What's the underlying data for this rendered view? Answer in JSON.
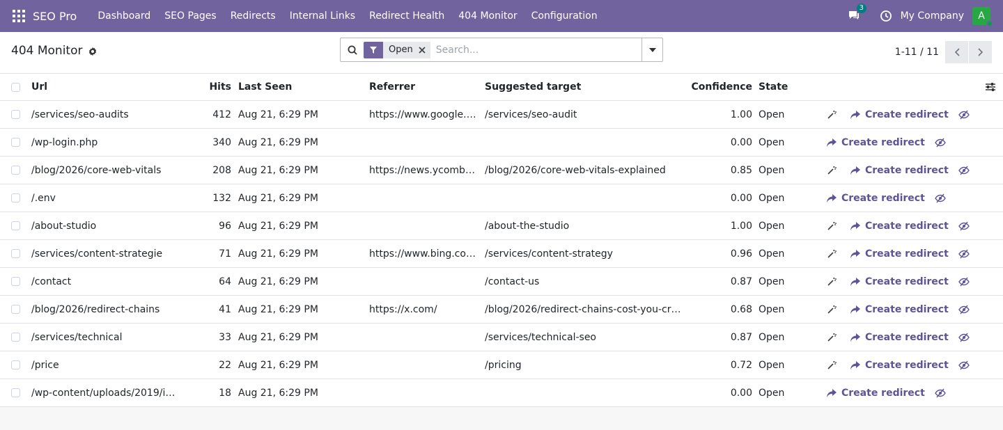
{
  "app": {
    "brand": "SEO Pro",
    "menu": [
      "Dashboard",
      "SEO Pages",
      "Redirects",
      "Internal Links",
      "Redirect Health",
      "404 Monitor",
      "Configuration"
    ],
    "chat_count": "3",
    "company": "My Company",
    "avatar_letter": "A",
    "accent_color": "#71639e"
  },
  "control": {
    "title": "404 Monitor",
    "facet": "Open",
    "search_placeholder": "Search...",
    "pager": "1-11 / 11"
  },
  "table": {
    "columns": {
      "url": "Url",
      "hits": "Hits",
      "last_seen": "Last Seen",
      "referrer": "Referrer",
      "target": "Suggested target",
      "confidence": "Confidence",
      "state": "State"
    },
    "create_label": "Create redirect",
    "rows": [
      {
        "url": "/services/seo-audits",
        "hits": "412",
        "last_seen": "Aug 21, 6:29 PM",
        "referrer": "https://www.google.c...",
        "target": "/services/seo-audit",
        "confidence": "1.00",
        "state": "Open",
        "has_suggestion": true
      },
      {
        "url": "/wp-login.php",
        "hits": "340",
        "last_seen": "Aug 21, 6:29 PM",
        "referrer": "",
        "target": "",
        "confidence": "0.00",
        "state": "Open",
        "has_suggestion": false
      },
      {
        "url": "/blog/2026/core-web-vitals",
        "hits": "208",
        "last_seen": "Aug 21, 6:29 PM",
        "referrer": "https://news.ycombin...",
        "target": "/blog/2026/core-web-vitals-explained",
        "confidence": "0.85",
        "state": "Open",
        "has_suggestion": true
      },
      {
        "url": "/.env",
        "hits": "132",
        "last_seen": "Aug 21, 6:29 PM",
        "referrer": "",
        "target": "",
        "confidence": "0.00",
        "state": "Open",
        "has_suggestion": false
      },
      {
        "url": "/about-studio",
        "hits": "96",
        "last_seen": "Aug 21, 6:29 PM",
        "referrer": "",
        "target": "/about-the-studio",
        "confidence": "1.00",
        "state": "Open",
        "has_suggestion": true
      },
      {
        "url": "/services/content-strategie",
        "hits": "71",
        "last_seen": "Aug 21, 6:29 PM",
        "referrer": "https://www.bing.com/",
        "target": "/services/content-strategy",
        "confidence": "0.96",
        "state": "Open",
        "has_suggestion": true
      },
      {
        "url": "/contact",
        "hits": "64",
        "last_seen": "Aug 21, 6:29 PM",
        "referrer": "",
        "target": "/contact-us",
        "confidence": "0.87",
        "state": "Open",
        "has_suggestion": true
      },
      {
        "url": "/blog/2026/redirect-chains",
        "hits": "41",
        "last_seen": "Aug 21, 6:29 PM",
        "referrer": "https://x.com/",
        "target": "/blog/2026/redirect-chains-cost-you-crawl...",
        "confidence": "0.68",
        "state": "Open",
        "has_suggestion": true
      },
      {
        "url": "/services/technical",
        "hits": "33",
        "last_seen": "Aug 21, 6:29 PM",
        "referrer": "",
        "target": "/services/technical-seo",
        "confidence": "0.87",
        "state": "Open",
        "has_suggestion": true
      },
      {
        "url": "/price",
        "hits": "22",
        "last_seen": "Aug 21, 6:29 PM",
        "referrer": "",
        "target": "/pricing",
        "confidence": "0.72",
        "state": "Open",
        "has_suggestion": true
      },
      {
        "url": "/wp-content/uploads/2019/in...",
        "hits": "18",
        "last_seen": "Aug 21, 6:29 PM",
        "referrer": "",
        "target": "",
        "confidence": "0.00",
        "state": "Open",
        "has_suggestion": false
      }
    ]
  }
}
